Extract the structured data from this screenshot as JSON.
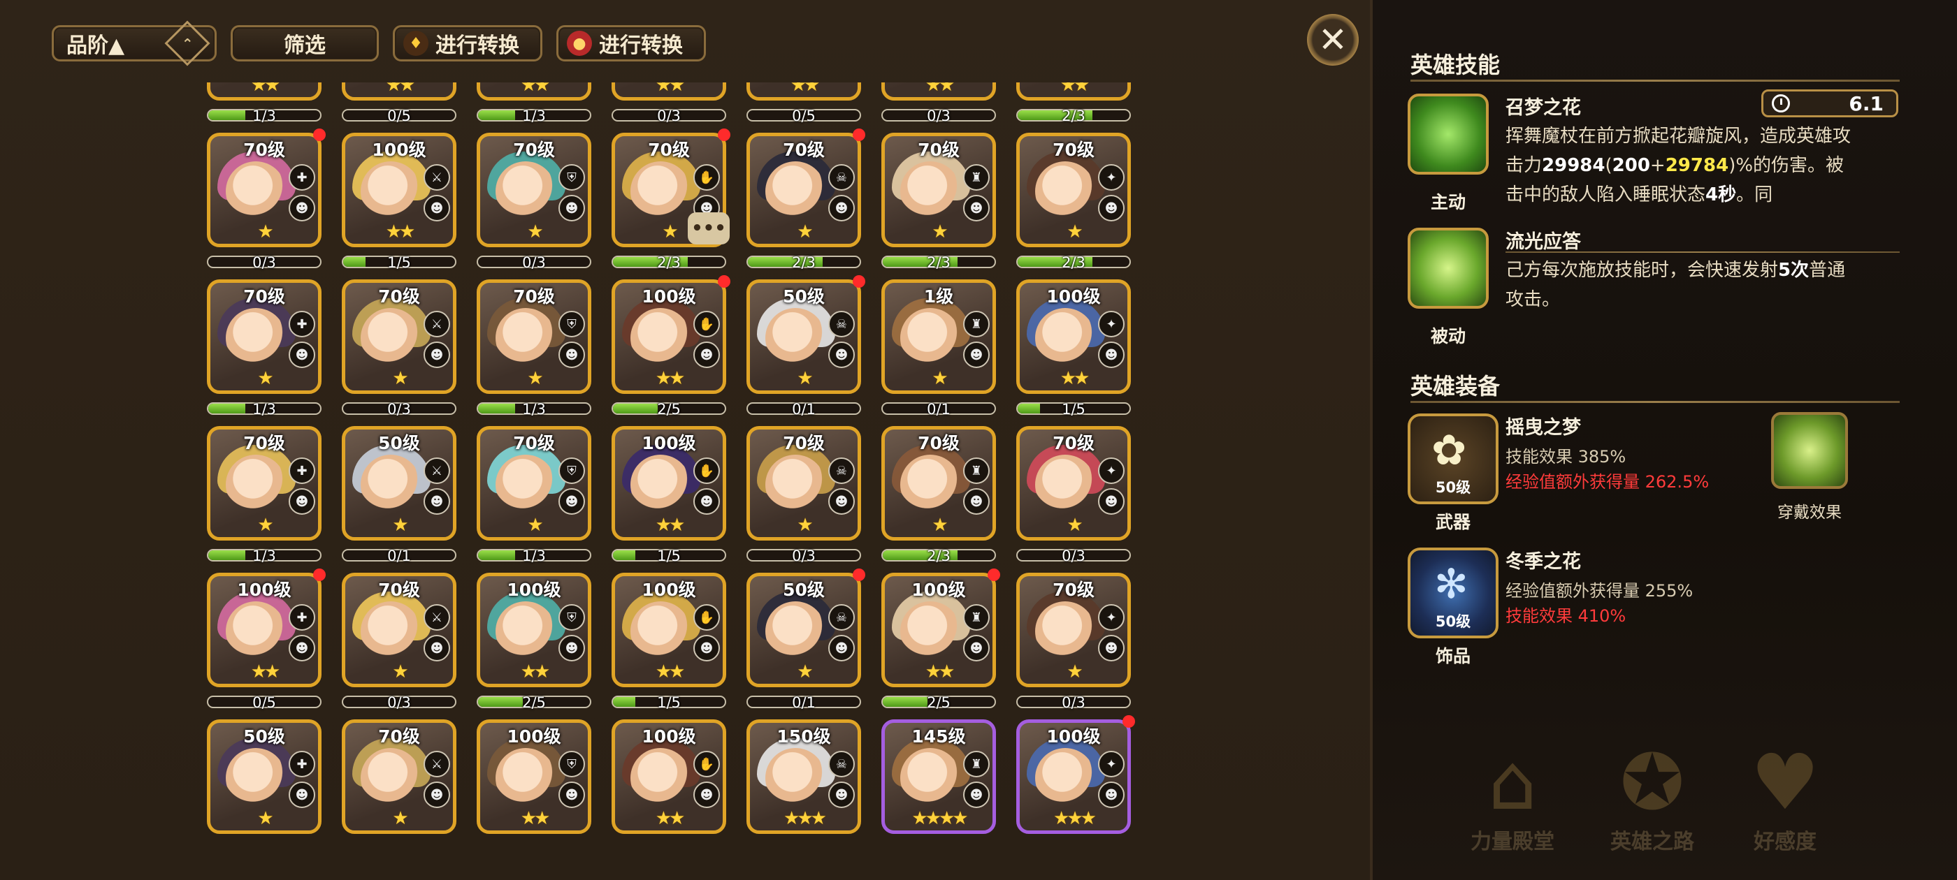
{
  "toolbar": {
    "sort_label": "品阶▲",
    "sort_icon": "sort-diamond-icon",
    "filter_label": "筛选",
    "convert1_label": "进行转换",
    "convert2_label": "进行转换"
  },
  "chat_bubble": "•••",
  "heroes": [
    {
      "level": "",
      "stars": "★★",
      "progress": "1/3",
      "fill": 0.33,
      "dot": false,
      "border": "gold"
    },
    {
      "level": "",
      "stars": "★★",
      "progress": "0/5",
      "fill": 0.0,
      "dot": false,
      "border": "gold"
    },
    {
      "level": "",
      "stars": "★★",
      "progress": "1/3",
      "fill": 0.33,
      "dot": false,
      "border": "gold"
    },
    {
      "level": "",
      "stars": "★★",
      "progress": "0/3",
      "fill": 0.0,
      "dot": false,
      "border": "gold"
    },
    {
      "level": "",
      "stars": "★★",
      "progress": "0/5",
      "fill": 0.0,
      "dot": false,
      "border": "gold"
    },
    {
      "level": "",
      "stars": "★★",
      "progress": "0/3",
      "fill": 0.0,
      "dot": false,
      "border": "gold"
    },
    {
      "level": "",
      "stars": "★★",
      "progress": "2/3",
      "fill": 0.67,
      "dot": false,
      "border": "gold"
    },
    {
      "level": "70级",
      "stars": "★",
      "progress": "0/3",
      "fill": 0.0,
      "dot": true,
      "border": "gold"
    },
    {
      "level": "100级",
      "stars": "★★",
      "progress": "1/5",
      "fill": 0.2,
      "dot": false,
      "border": "gold"
    },
    {
      "level": "70级",
      "stars": "★",
      "progress": "0/3",
      "fill": 0.0,
      "dot": false,
      "border": "gold"
    },
    {
      "level": "70级",
      "stars": "★",
      "progress": "2/3",
      "fill": 0.67,
      "dot": true,
      "border": "gold"
    },
    {
      "level": "70级",
      "stars": "★",
      "progress": "2/3",
      "fill": 0.67,
      "dot": true,
      "border": "gold"
    },
    {
      "level": "70级",
      "stars": "★",
      "progress": "2/3",
      "fill": 0.67,
      "dot": false,
      "border": "gold"
    },
    {
      "level": "70级",
      "stars": "★",
      "progress": "2/3",
      "fill": 0.67,
      "dot": false,
      "border": "gold"
    },
    {
      "level": "70级",
      "stars": "★",
      "progress": "1/3",
      "fill": 0.33,
      "dot": false,
      "border": "gold"
    },
    {
      "level": "70级",
      "stars": "★",
      "progress": "0/3",
      "fill": 0.0,
      "dot": false,
      "border": "gold"
    },
    {
      "level": "70级",
      "stars": "★",
      "progress": "1/3",
      "fill": 0.33,
      "dot": false,
      "border": "gold"
    },
    {
      "level": "100级",
      "stars": "★★",
      "progress": "2/5",
      "fill": 0.4,
      "dot": true,
      "border": "gold"
    },
    {
      "level": "50级",
      "stars": "★",
      "progress": "0/1",
      "fill": 0.0,
      "dot": true,
      "border": "gold"
    },
    {
      "level": "1级",
      "stars": "★",
      "progress": "0/1",
      "fill": 0.0,
      "dot": false,
      "border": "gold"
    },
    {
      "level": "100级",
      "stars": "★★",
      "progress": "1/5",
      "fill": 0.2,
      "dot": false,
      "border": "gold"
    },
    {
      "level": "70级",
      "stars": "★",
      "progress": "1/3",
      "fill": 0.33,
      "dot": false,
      "border": "gold"
    },
    {
      "level": "50级",
      "stars": "★",
      "progress": "0/1",
      "fill": 0.0,
      "dot": false,
      "border": "gold"
    },
    {
      "level": "70级",
      "stars": "★",
      "progress": "1/3",
      "fill": 0.33,
      "dot": false,
      "border": "gold"
    },
    {
      "level": "100级",
      "stars": "★★",
      "progress": "1/5",
      "fill": 0.2,
      "dot": false,
      "border": "gold"
    },
    {
      "level": "70级",
      "stars": "★",
      "progress": "0/3",
      "fill": 0.0,
      "dot": false,
      "border": "gold"
    },
    {
      "level": "70级",
      "stars": "★",
      "progress": "2/3",
      "fill": 0.67,
      "dot": false,
      "border": "gold"
    },
    {
      "level": "70级",
      "stars": "★",
      "progress": "0/3",
      "fill": 0.0,
      "dot": false,
      "border": "gold"
    },
    {
      "level": "100级",
      "stars": "★★",
      "progress": "0/5",
      "fill": 0.0,
      "dot": true,
      "border": "gold"
    },
    {
      "level": "70级",
      "stars": "★",
      "progress": "0/3",
      "fill": 0.0,
      "dot": false,
      "border": "gold"
    },
    {
      "level": "100级",
      "stars": "★★",
      "progress": "2/5",
      "fill": 0.4,
      "dot": false,
      "border": "gold"
    },
    {
      "level": "100级",
      "stars": "★★",
      "progress": "1/5",
      "fill": 0.2,
      "dot": false,
      "border": "gold"
    },
    {
      "level": "50级",
      "stars": "★",
      "progress": "0/1",
      "fill": 0.0,
      "dot": true,
      "border": "gold"
    },
    {
      "level": "100级",
      "stars": "★★",
      "progress": "2/5",
      "fill": 0.4,
      "dot": true,
      "border": "gold"
    },
    {
      "level": "70级",
      "stars": "★",
      "progress": "0/3",
      "fill": 0.0,
      "dot": false,
      "border": "gold"
    },
    {
      "level": "50级",
      "stars": "★",
      "progress": "",
      "fill": 0.0,
      "dot": false,
      "border": "gold"
    },
    {
      "level": "70级",
      "stars": "★",
      "progress": "",
      "fill": 0.0,
      "dot": false,
      "border": "gold"
    },
    {
      "level": "100级",
      "stars": "★★",
      "progress": "",
      "fill": 0.0,
      "dot": false,
      "border": "gold"
    },
    {
      "level": "100级",
      "stars": "★★",
      "progress": "",
      "fill": 0.0,
      "dot": false,
      "border": "gold"
    },
    {
      "level": "150级",
      "stars": "★★★",
      "progress": "",
      "fill": 0.0,
      "dot": false,
      "border": "gold"
    },
    {
      "level": "145级",
      "stars": "★★★★",
      "progress": "",
      "fill": 0.0,
      "dot": false,
      "border": "purple"
    },
    {
      "level": "100级",
      "stars": "★★★",
      "progress": "",
      "fill": 0.0,
      "dot": true,
      "border": "purple"
    }
  ],
  "panel": {
    "skills_title": "英雄技能",
    "skill1": {
      "name": "召梦之花",
      "tag": "主动",
      "cooldown": "6.1",
      "desc_1": "挥舞魔杖在前方掀起花瓣旋风，造成英雄攻击力",
      "v1": "29984",
      "p_open": "(",
      "v2": "200",
      "plus": "+",
      "v3": "29784",
      "desc_2": ")%的伤害。被击中的敌人陷入睡眠状态",
      "v4": "4秒",
      "desc_3": "。同"
    },
    "skill2": {
      "name": "流光应答",
      "tag": "被动",
      "desc_1": "己方每次施放技能时，会快速发射",
      "v1": "5次",
      "desc_2": "普通攻击。"
    },
    "equip_title": "英雄装备",
    "weapon": {
      "name": "摇曳之梦",
      "level": "50级",
      "tag": "武器",
      "stat1": "技能效果 385%",
      "stat2": "经验值额外获得量 262.5%"
    },
    "accessory": {
      "name": "冬季之花",
      "level": "50级",
      "tag": "饰品",
      "stat1": "经验值额外获得量 255%",
      "stat2": "技能效果 410%"
    },
    "wear_label": "穿戴效果"
  },
  "bottom_nav": [
    {
      "label": "力量殿堂",
      "icon": "temple-icon"
    },
    {
      "label": "英雄之路",
      "icon": "hero-road-icon"
    },
    {
      "label": "好感度",
      "icon": "heart-icon"
    }
  ]
}
